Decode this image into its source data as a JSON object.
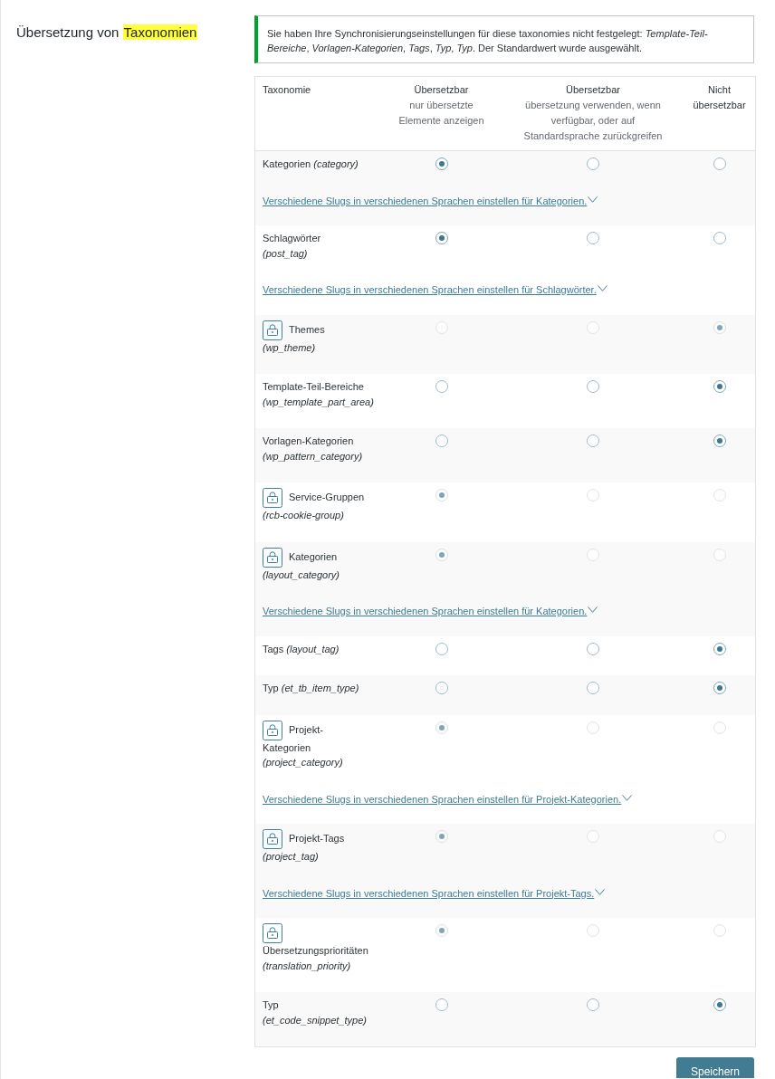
{
  "title": {
    "parts": [
      {
        "text": "Übersetzung von",
        "highlighted": false
      },
      {
        "text": "Taxonomien",
        "highlighted": true
      }
    ]
  },
  "notice": {
    "text": "Sie haben Ihre Synchronisierungseinstellungen für diese taxonomies nicht festgelegt: *Template-Teil-Bereiche*, *Vorlagen-Kategorien*, *Tags*, *Typ*, *Typ*. Der Standardwert wurde ausgewählt."
  },
  "table": {
    "columns": [
      {
        "title": "Taxonomie"
      },
      {
        "title": "Übersetzbar",
        "subtitle": "nur übersetzte Elemente anzeigen"
      },
      {
        "title": "Übersetzbar",
        "subtitle": "übersetzung verwenden, wenn verfügbar, oder auf Standardsprache zurückgreifen"
      },
      {
        "title": "Nicht übersetzbar"
      }
    ],
    "rows": [
      {
        "label": "Kategorien *(category)*",
        "locked": false,
        "options": [
          {
            "selected": true
          },
          {
            "selected": false
          },
          {
            "selected": false
          }
        ],
        "link": "Verschiedene Slugs in verschiedenen Sprachen einstellen für Kategorien."
      },
      {
        "label": "Schlagwörter *(post_tag)*",
        "locked": false,
        "options": [
          {
            "selected": true
          },
          {
            "selected": false
          },
          {
            "selected": false
          }
        ],
        "link": "Verschiedene Slugs in verschiedenen Sprachen einstellen für Schlagwörter."
      },
      {
        "label": "Themes *(wp_theme)*",
        "locked": true,
        "options": [
          {
            "selected": false
          },
          {
            "selected": false
          },
          {
            "selected": true
          }
        ]
      },
      {
        "label": "Template-Teil-Bereiche *(wp_template_part_area)*",
        "locked": false,
        "options": [
          {
            "selected": false
          },
          {
            "selected": false
          },
          {
            "selected": true
          }
        ]
      },
      {
        "label": "Vorlagen-Kategorien *(wp_pattern_category)*",
        "locked": false,
        "options": [
          {
            "selected": false
          },
          {
            "selected": false
          },
          {
            "selected": true
          }
        ]
      },
      {
        "label": "Service-Gruppen *(rcb-cookie-group)*",
        "locked": true,
        "options": [
          {
            "selected": true
          },
          {
            "selected": false
          },
          {
            "selected": false
          }
        ]
      },
      {
        "label": "Kategorien *(layout_category)*",
        "locked": true,
        "options": [
          {
            "selected": true
          },
          {
            "selected": false
          },
          {
            "selected": false
          }
        ],
        "link": "Verschiedene Slugs in verschiedenen Sprachen einstellen für Kategorien."
      },
      {
        "label": "Tags *(layout_tag)*",
        "locked": false,
        "options": [
          {
            "selected": false
          },
          {
            "selected": false
          },
          {
            "selected": true
          }
        ]
      },
      {
        "label": "Typ *(et_tb_item_type)*",
        "locked": false,
        "options": [
          {
            "selected": false
          },
          {
            "selected": false
          },
          {
            "selected": true
          }
        ]
      },
      {
        "label": "Projekt-Kategorien *(project_category)*",
        "locked": true,
        "options": [
          {
            "selected": true
          },
          {
            "selected": false
          },
          {
            "selected": false
          }
        ],
        "link": "Verschiedene Slugs in verschiedenen Sprachen einstellen für Projekt-Kategorien."
      },
      {
        "label": "Projekt-Tags *(project_tag)*",
        "locked": true,
        "options": [
          {
            "selected": true
          },
          {
            "selected": false
          },
          {
            "selected": false
          }
        ],
        "link": "Verschiedene Slugs in verschiedenen Sprachen einstellen für Projekt-Tags."
      },
      {
        "label": "Übersetzungsprioritäten *(translation_priority)*",
        "locked": true,
        "options": [
          {
            "selected": true
          },
          {
            "selected": false
          },
          {
            "selected": false
          }
        ]
      },
      {
        "label": "Typ *(et_code_snippet_type)*",
        "locked": false,
        "options": [
          {
            "selected": false
          },
          {
            "selected": false
          },
          {
            "selected": true
          }
        ]
      }
    ]
  },
  "save_button": {
    "label": "Speichern"
  }
}
